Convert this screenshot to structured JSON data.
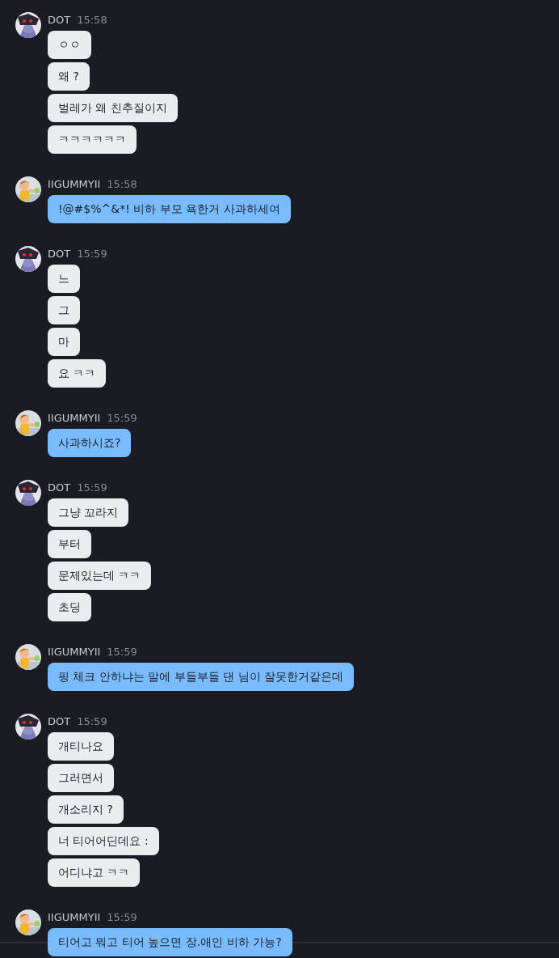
{
  "messages": [
    {
      "kind": "other",
      "author": "DOT",
      "time": "15:58",
      "lines": [
        "ㅇㅇ",
        "왜 ?",
        "벌레가 왜 친추질이지",
        "ㅋㅋㅋㅋㅋㅋ"
      ]
    },
    {
      "kind": "self",
      "author": "IIGUMMYII",
      "time": "15:58",
      "lines": [
        "!@#$%^&*! 비하 부모 욕한거 사과하세여"
      ]
    },
    {
      "kind": "other",
      "author": "DOT",
      "time": "15:59",
      "lines": [
        "느",
        "그",
        "마",
        "요 ㅋㅋ"
      ]
    },
    {
      "kind": "self",
      "author": "IIGUMMYII",
      "time": "15:59",
      "lines": [
        "사과하시죠?"
      ]
    },
    {
      "kind": "other",
      "author": "DOT",
      "time": "15:59",
      "lines": [
        "그냥 꼬라지",
        "부터",
        "문제있는데 ㅋㅋ",
        "초딩"
      ]
    },
    {
      "kind": "self",
      "author": "IIGUMMYII",
      "time": "15:59",
      "lines": [
        "핑 체크 안하냐는 말에 부들부들 댄 님이 잘못한거같은데"
      ]
    },
    {
      "kind": "other",
      "author": "DOT",
      "time": "15:59",
      "lines": [
        "개티나요",
        "그러면서",
        "개소리지 ?",
        "너 티어어딘데요 :",
        "어디냐고 ㅋㅋ"
      ]
    },
    {
      "kind": "self",
      "author": "IIGUMMYII",
      "time": "15:59",
      "lines": [
        "티어고 뭐고 티어 높으면 장.애인 비하 가능?"
      ]
    }
  ]
}
